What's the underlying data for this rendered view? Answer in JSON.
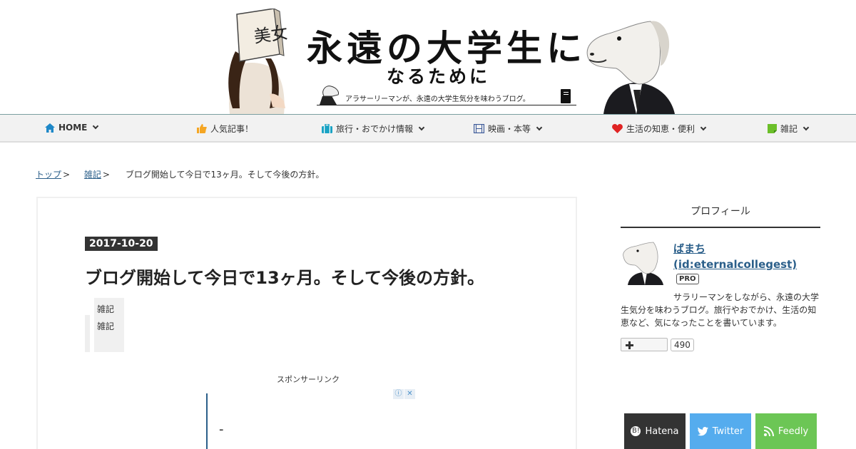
{
  "header": {
    "title_main": "永遠の大学生に",
    "title_sub": "なるために",
    "tagline": "アラサーリーマンが、永遠の大学生気分を味わうブログ。",
    "sign_text": "美女"
  },
  "nav": {
    "items": [
      {
        "label": "HOME",
        "icon": "home-icon",
        "color": "#1e88c8",
        "has_dropdown": true
      },
      {
        "label": "人気記事！",
        "icon": "thumbs-up-icon",
        "color": "#f5a623",
        "has_dropdown": false
      },
      {
        "label": "旅行・おでかけ情報",
        "icon": "suitcase-icon",
        "color": "#1aa3c4",
        "has_dropdown": true
      },
      {
        "label": "映画・本等",
        "icon": "film-icon",
        "color": "#3d5a99",
        "has_dropdown": true
      },
      {
        "label": "生活の知恵・便利",
        "icon": "heart-icon",
        "color": "#e02424",
        "has_dropdown": true
      },
      {
        "label": "雑記",
        "icon": "note-icon",
        "color": "#6cbf2a",
        "has_dropdown": true
      }
    ]
  },
  "breadcrumb": {
    "items": [
      "トップ",
      "雑記"
    ],
    "separator": ">",
    "current": "ブログ開始して今日で13ヶ月。そして今後の方針。"
  },
  "article": {
    "date": "2017-10-20",
    "title": "ブログ開始して今日で13ヶ月。そして今後の方針。",
    "category": "雑記雑記",
    "ad_label": "スポンサーリンク",
    "ad_dash": "-"
  },
  "sidebar": {
    "title": "プロフィール",
    "profile": {
      "name": "ばまち",
      "id": "(id:eternalcollegest)",
      "badge": "PRO",
      "description": "サラリーマンをしながら、永遠の大学生気分を味わうブログ。旅行やおでかけ、生活の知恵など、気になったことを書いています。"
    },
    "follow": {
      "count": "490"
    }
  },
  "share": [
    {
      "label": "Hatena",
      "color": "#333333",
      "icon": "hatena-icon"
    },
    {
      "label": "Twitter",
      "color": "#55acee",
      "icon": "twitter-bird-icon"
    },
    {
      "label": "Feedly",
      "color": "#6cc655",
      "icon": "rss-icon"
    }
  ]
}
